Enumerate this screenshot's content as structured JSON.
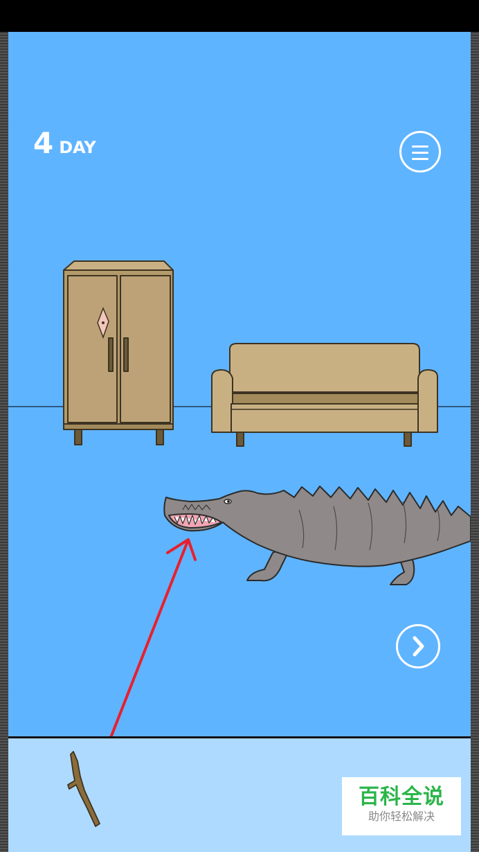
{
  "hud": {
    "day_number": "4",
    "day_label": "DAY",
    "menu_icon": "hamburger-menu-icon",
    "next_icon": "chevron-right-icon"
  },
  "scene": {
    "background_color": "#5fb4ff",
    "objects": [
      "wardrobe",
      "sofa",
      "crocodile",
      "stick",
      "arrow"
    ]
  },
  "inventory": {
    "background_color": "#aedaff",
    "items": [
      {
        "name": "stick"
      }
    ]
  },
  "hint": {
    "arrow_color": "#e8202e"
  },
  "watermark": {
    "title": "百科全说",
    "subtitle": "助你轻松解决"
  }
}
